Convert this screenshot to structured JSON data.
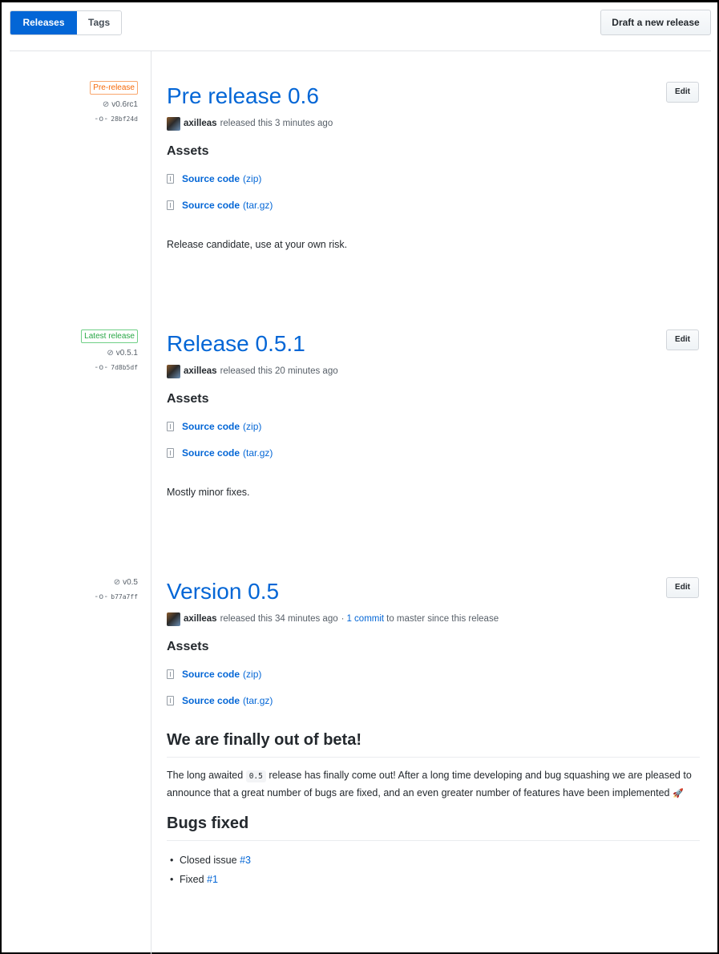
{
  "tabs": {
    "releases": "Releases",
    "tags": "Tags"
  },
  "draft_button": "Draft a new release",
  "edit_label": "Edit",
  "assets_heading": "Assets",
  "source_code": "Source code",
  "releases": [
    {
      "label": "Pre-release",
      "tag": "v0.6rc1",
      "commit": "28bf24d",
      "title": "Pre release 0.6",
      "author": "axilleas",
      "when": "released this 3 minutes ago",
      "assets": [
        "(zip)",
        "(tar.gz)"
      ],
      "description": "Release candidate, use at your own risk."
    },
    {
      "label": "Latest release",
      "tag": "v0.5.1",
      "commit": "7d8b5df",
      "title": "Release 0.5.1",
      "author": "axilleas",
      "when": "released this 20 minutes ago",
      "assets": [
        "(zip)",
        "(tar.gz)"
      ],
      "description": "Mostly minor fixes."
    },
    {
      "tag": "v0.5",
      "commit": "b77a7ff",
      "title": "Version 0.5",
      "author": "axilleas",
      "when": "released this 34 minutes ago",
      "sep": "·",
      "commits_link": "1 commit",
      "commits_suffix": "to master since this release",
      "assets": [
        "(zip)",
        "(tar.gz)"
      ],
      "notes": {
        "heading": "We are finally out of beta!",
        "para_pre": "The long awaited",
        "code": "0.5",
        "para_post": "release has finally come out! After a long time developing and bug squashing we are pleased to announce that a great number of bugs are fixed, and an even greater number of features have been implemented",
        "emoji": "🚀",
        "bugs_heading": "Bugs fixed",
        "bugs": [
          {
            "text": "Closed issue",
            "link": "#3"
          },
          {
            "text": "Fixed",
            "link": "#1"
          }
        ]
      }
    }
  ]
}
